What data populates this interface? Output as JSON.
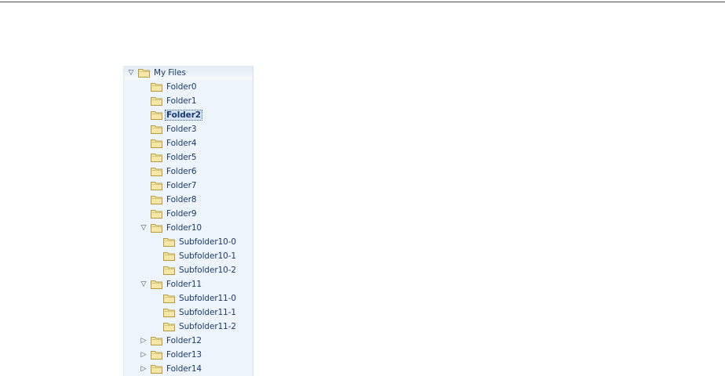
{
  "tree": {
    "root": {
      "label": "My Files",
      "expanded": true,
      "icon": "folder-icon"
    },
    "items": [
      {
        "label": "Folder0",
        "level": 1,
        "expander": "none"
      },
      {
        "label": "Folder1",
        "level": 1,
        "expander": "none"
      },
      {
        "label": "Folder2",
        "level": 1,
        "expander": "none",
        "selected": true
      },
      {
        "label": "Folder3",
        "level": 1,
        "expander": "none"
      },
      {
        "label": "Folder4",
        "level": 1,
        "expander": "none"
      },
      {
        "label": "Folder5",
        "level": 1,
        "expander": "none"
      },
      {
        "label": "Folder6",
        "level": 1,
        "expander": "none"
      },
      {
        "label": "Folder7",
        "level": 1,
        "expander": "none"
      },
      {
        "label": "Folder8",
        "level": 1,
        "expander": "none"
      },
      {
        "label": "Folder9",
        "level": 1,
        "expander": "none"
      },
      {
        "label": "Folder10",
        "level": 1,
        "expander": "expanded"
      },
      {
        "label": "Subfolder10-0",
        "level": 2,
        "expander": "none"
      },
      {
        "label": "Subfolder10-1",
        "level": 2,
        "expander": "none"
      },
      {
        "label": "Subfolder10-2",
        "level": 2,
        "expander": "none"
      },
      {
        "label": "Folder11",
        "level": 1,
        "expander": "expanded"
      },
      {
        "label": "Subfolder11-0",
        "level": 2,
        "expander": "none"
      },
      {
        "label": "Subfolder11-1",
        "level": 2,
        "expander": "none"
      },
      {
        "label": "Subfolder11-2",
        "level": 2,
        "expander": "none"
      },
      {
        "label": "Folder12",
        "level": 1,
        "expander": "collapsed"
      },
      {
        "label": "Folder13",
        "level": 1,
        "expander": "collapsed"
      },
      {
        "label": "Folder14",
        "level": 1,
        "expander": "collapsed"
      }
    ]
  },
  "icons": {
    "expanded": "triangle-down-icon",
    "collapsed": "triangle-right-icon",
    "folder": "folder-icon"
  },
  "colors": {
    "panel_background": "#eef4fb",
    "label_text": "#1b3a6b",
    "folder_fill": "#f6e7a6",
    "folder_stroke": "#b89a3e"
  }
}
